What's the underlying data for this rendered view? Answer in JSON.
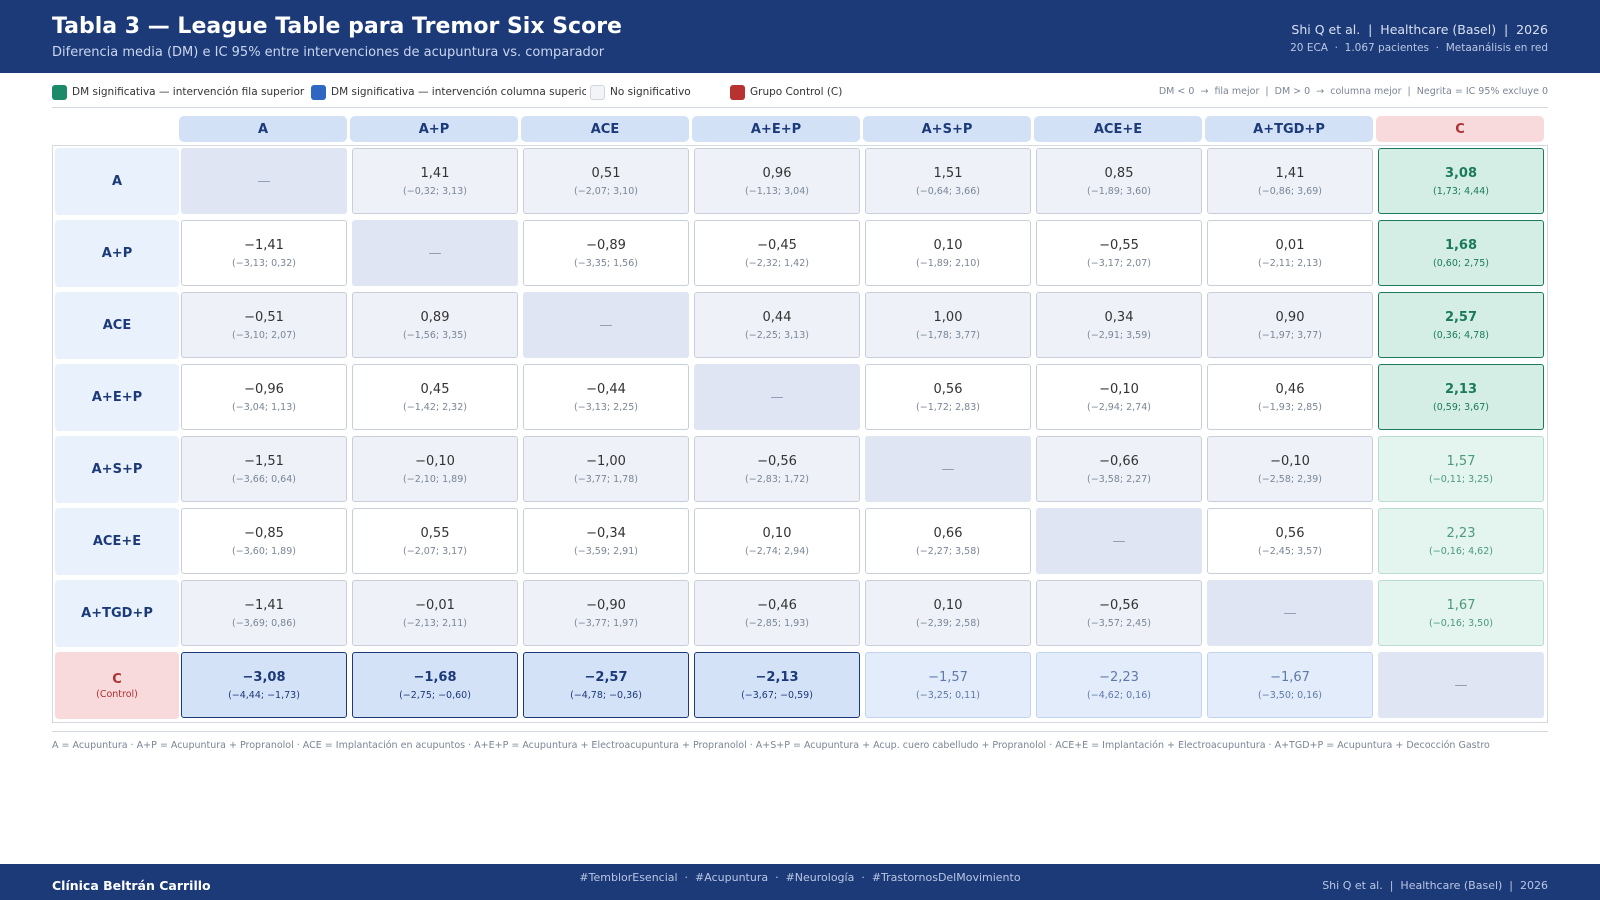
{
  "header": {
    "title": "Tabla 3 — League Table para Tremor Six Score",
    "subtitle": "Diferencia media (DM) e IC 95% entre intervenciones de acupuntura vs. comparador",
    "citation": "Shi Q et al.  |  Healthcare (Basel)  |  2026",
    "stats": "20 ECA  ·  1.067 pacientes  ·  Metaanálisis en red"
  },
  "legend": {
    "items": [
      {
        "label": "DM significativa — intervención fila superior",
        "color": "#1b8a68"
      },
      {
        "label": "DM significativa — intervención columna superior",
        "color": "#2f66c2"
      },
      {
        "label": "No significativo",
        "color": "#f2f4f8"
      },
      {
        "label": "Grupo Control (C)",
        "color": "#b83232"
      }
    ],
    "note": "DM < 0  →  fila mejor  |  DM > 0  →  columna mejor  |  Negrita = IC 95% excluye 0"
  },
  "columns": [
    "A",
    "A+P",
    "ACE",
    "A+E+P",
    "A+S+P",
    "ACE+E",
    "A+TGD+P",
    "C"
  ],
  "rows": [
    {
      "label": "A",
      "sub": "",
      "cells": [
        {
          "v": "—",
          "ci": "",
          "t": "diag"
        },
        {
          "v": "1,41",
          "ci": "(−0,32; 3,13)",
          "t": "ns"
        },
        {
          "v": "0,51",
          "ci": "(−2,07; 3,10)",
          "t": "ns"
        },
        {
          "v": "0,96",
          "ci": "(−1,13; 3,04)",
          "t": "ns"
        },
        {
          "v": "1,51",
          "ci": "(−0,64; 3,66)",
          "t": "ns"
        },
        {
          "v": "0,85",
          "ci": "(−1,89; 3,60)",
          "t": "ns"
        },
        {
          "v": "1,41",
          "ci": "(−0,86; 3,69)",
          "t": "ns"
        },
        {
          "v": "3,08",
          "ci": "(1,73; 4,44)",
          "t": "sig-row"
        }
      ]
    },
    {
      "label": "A+P",
      "sub": "",
      "cells": [
        {
          "v": "−1,41",
          "ci": "(−3,13; 0,32)",
          "t": "ns"
        },
        {
          "v": "—",
          "ci": "",
          "t": "diag"
        },
        {
          "v": "−0,89",
          "ci": "(−3,35; 1,56)",
          "t": "ns"
        },
        {
          "v": "−0,45",
          "ci": "(−2,32; 1,42)",
          "t": "ns"
        },
        {
          "v": "0,10",
          "ci": "(−1,89; 2,10)",
          "t": "ns"
        },
        {
          "v": "−0,55",
          "ci": "(−3,17; 2,07)",
          "t": "ns"
        },
        {
          "v": "0,01",
          "ci": "(−2,11; 2,13)",
          "t": "ns"
        },
        {
          "v": "1,68",
          "ci": "(0,60; 2,75)",
          "t": "sig-row"
        }
      ]
    },
    {
      "label": "ACE",
      "sub": "",
      "cells": [
        {
          "v": "−0,51",
          "ci": "(−3,10; 2,07)",
          "t": "ns"
        },
        {
          "v": "0,89",
          "ci": "(−1,56; 3,35)",
          "t": "ns"
        },
        {
          "v": "—",
          "ci": "",
          "t": "diag"
        },
        {
          "v": "0,44",
          "ci": "(−2,25; 3,13)",
          "t": "ns"
        },
        {
          "v": "1,00",
          "ci": "(−1,78; 3,77)",
          "t": "ns"
        },
        {
          "v": "0,34",
          "ci": "(−2,91; 3,59)",
          "t": "ns"
        },
        {
          "v": "0,90",
          "ci": "(−1,97; 3,77)",
          "t": "ns"
        },
        {
          "v": "2,57",
          "ci": "(0,36; 4,78)",
          "t": "sig-row"
        }
      ]
    },
    {
      "label": "A+E+P",
      "sub": "",
      "cells": [
        {
          "v": "−0,96",
          "ci": "(−3,04; 1,13)",
          "t": "ns"
        },
        {
          "v": "0,45",
          "ci": "(−1,42; 2,32)",
          "t": "ns"
        },
        {
          "v": "−0,44",
          "ci": "(−3,13; 2,25)",
          "t": "ns"
        },
        {
          "v": "—",
          "ci": "",
          "t": "diag"
        },
        {
          "v": "0,56",
          "ci": "(−1,72; 2,83)",
          "t": "ns"
        },
        {
          "v": "−0,10",
          "ci": "(−2,94; 2,74)",
          "t": "ns"
        },
        {
          "v": "0,46",
          "ci": "(−1,93; 2,85)",
          "t": "ns"
        },
        {
          "v": "2,13",
          "ci": "(0,59; 3,67)",
          "t": "sig-row"
        }
      ]
    },
    {
      "label": "A+S+P",
      "sub": "",
      "cells": [
        {
          "v": "−1,51",
          "ci": "(−3,66; 0,64)",
          "t": "ns"
        },
        {
          "v": "−0,10",
          "ci": "(−2,10; 1,89)",
          "t": "ns"
        },
        {
          "v": "−1,00",
          "ci": "(−3,77; 1,78)",
          "t": "ns"
        },
        {
          "v": "−0,56",
          "ci": "(−2,83; 1,72)",
          "t": "ns"
        },
        {
          "v": "—",
          "ci": "",
          "t": "diag"
        },
        {
          "v": "−0,66",
          "ci": "(−3,58; 2,27)",
          "t": "ns"
        },
        {
          "v": "−0,10",
          "ci": "(−2,58; 2,39)",
          "t": "ns"
        },
        {
          "v": "1,57",
          "ci": "(−0,11; 3,25)",
          "t": "ns-ctrlcol"
        }
      ]
    },
    {
      "label": "ACE+E",
      "sub": "",
      "cells": [
        {
          "v": "−0,85",
          "ci": "(−3,60; 1,89)",
          "t": "ns"
        },
        {
          "v": "0,55",
          "ci": "(−2,07; 3,17)",
          "t": "ns"
        },
        {
          "v": "−0,34",
          "ci": "(−3,59; 2,91)",
          "t": "ns"
        },
        {
          "v": "0,10",
          "ci": "(−2,74; 2,94)",
          "t": "ns"
        },
        {
          "v": "0,66",
          "ci": "(−2,27; 3,58)",
          "t": "ns"
        },
        {
          "v": "—",
          "ci": "",
          "t": "diag"
        },
        {
          "v": "0,56",
          "ci": "(−2,45; 3,57)",
          "t": "ns"
        },
        {
          "v": "2,23",
          "ci": "(−0,16; 4,62)",
          "t": "ns-ctrlcol"
        }
      ]
    },
    {
      "label": "A+TGD+P",
      "sub": "",
      "cells": [
        {
          "v": "−1,41",
          "ci": "(−3,69; 0,86)",
          "t": "ns"
        },
        {
          "v": "−0,01",
          "ci": "(−2,13; 2,11)",
          "t": "ns"
        },
        {
          "v": "−0,90",
          "ci": "(−3,77; 1,97)",
          "t": "ns"
        },
        {
          "v": "−0,46",
          "ci": "(−2,85; 1,93)",
          "t": "ns"
        },
        {
          "v": "0,10",
          "ci": "(−2,39; 2,58)",
          "t": "ns"
        },
        {
          "v": "−0,56",
          "ci": "(−3,57; 2,45)",
          "t": "ns"
        },
        {
          "v": "—",
          "ci": "",
          "t": "diag"
        },
        {
          "v": "1,67",
          "ci": "(−0,16; 3,50)",
          "t": "ns-ctrlcol"
        }
      ]
    },
    {
      "label": "C",
      "sub": "(Control)",
      "cells": [
        {
          "v": "−3,08",
          "ci": "(−4,44; −1,73)",
          "t": "sig-col"
        },
        {
          "v": "−1,68",
          "ci": "(−2,75; −0,60)",
          "t": "sig-col"
        },
        {
          "v": "−2,57",
          "ci": "(−4,78; −0,36)",
          "t": "sig-col"
        },
        {
          "v": "−2,13",
          "ci": "(−3,67; −0,59)",
          "t": "sig-col"
        },
        {
          "v": "−1,57",
          "ci": "(−3,25; 0,11)",
          "t": "ns-ctrlrow"
        },
        {
          "v": "−2,23",
          "ci": "(−4,62; 0,16)",
          "t": "ns-ctrlrow"
        },
        {
          "v": "−1,67",
          "ci": "(−3,50; 0,16)",
          "t": "ns-ctrlrow"
        },
        {
          "v": "—",
          "ci": "",
          "t": "diag"
        }
      ]
    }
  ],
  "footnote": "A = Acupuntura  ·  A+P = Acupuntura + Propranolol  ·  ACE = Implantación en acupuntos  ·  A+E+P = Acupuntura + Electroacupuntura + Propranolol  ·  A+S+P = Acupuntura + Acup. cuero cabelludo + Propranolol  ·  ACE+E = Implantación + Electroacupuntura  ·  A+TGD+P = Acupuntura + Decocción Gastro",
  "footer": {
    "org": "Clínica Beltrán Carrillo",
    "tags": "#TemblorEsencial  ·  #Acupuntura  ·  #Neurología  ·  #TrastornosDelMovimiento",
    "citation": "Shi Q et al.  |  Healthcare (Basel)  |  2026"
  }
}
